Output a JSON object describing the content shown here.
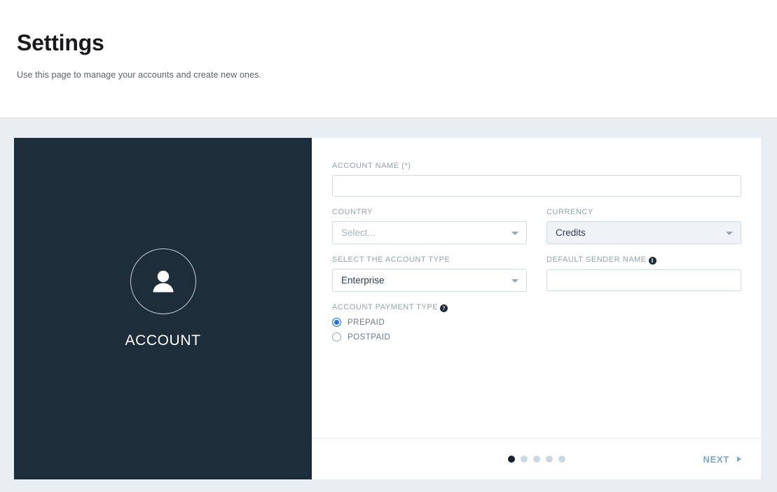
{
  "header": {
    "title": "Settings",
    "subtitle": "Use this page to manage your accounts and create new ones."
  },
  "side_panel": {
    "icon": "user-icon",
    "label": "ACCOUNT"
  },
  "form": {
    "account_name": {
      "label": "ACCOUNT NAME (*)",
      "value": "",
      "placeholder": ""
    },
    "country": {
      "label": "COUNTRY",
      "value": "Select...",
      "caret_icon": "chevron-down-icon"
    },
    "currency": {
      "label": "CURRENCY",
      "value": "Credits",
      "caret_icon": "chevron-down-icon"
    },
    "account_type": {
      "label": "SELECT THE ACCOUNT TYPE",
      "value": "Enterprise",
      "caret_icon": "chevron-down-icon"
    },
    "sender_name": {
      "label": "DEFAULT SENDER NAME",
      "label_icon": "info-icon",
      "label_icon_glyph": "i",
      "value": "",
      "placeholder": ""
    },
    "payment_type": {
      "label": "ACCOUNT PAYMENT TYPE",
      "label_icon": "help-icon",
      "label_icon_glyph": "?",
      "options": [
        {
          "label": "PREPAID",
          "selected": true
        },
        {
          "label": "POSTPAID",
          "selected": false
        }
      ]
    }
  },
  "footer": {
    "steps": {
      "total": 5,
      "current": 1
    },
    "next_label": "NEXT",
    "next_icon": "arrow-right-icon"
  },
  "colors": {
    "panel_dark": "#1d2d3a",
    "page_background": "#e8eef1",
    "accent_radio": "#1a73e8",
    "next_link": "#7fa6c9",
    "label_text": "#93a2ad",
    "dot_active": "#12232e",
    "dot_inactive": "#ccd8e1"
  }
}
